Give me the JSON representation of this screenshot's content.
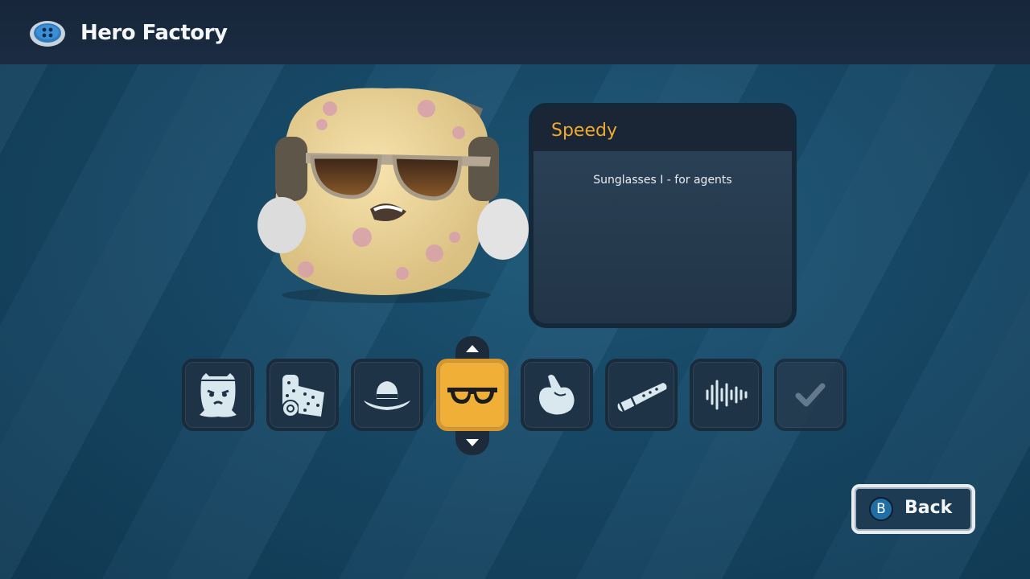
{
  "header": {
    "title": "Hero Factory",
    "logo_icon": "button-logo-icon"
  },
  "character": {
    "description_icon": "plush-character-with-sunglasses-and-headphones"
  },
  "info_panel": {
    "name": "Speedy",
    "description": "Sunglasses I - for agents"
  },
  "slots": [
    {
      "id": "body",
      "icon": "body-icon",
      "selected": false,
      "enabled": true
    },
    {
      "id": "pattern",
      "icon": "fabric-pattern-icon",
      "selected": false,
      "enabled": true
    },
    {
      "id": "hat",
      "icon": "hat-icon",
      "selected": false,
      "enabled": true
    },
    {
      "id": "glasses",
      "icon": "glasses-icon",
      "selected": true,
      "enabled": true
    },
    {
      "id": "hands",
      "icon": "hand-icon",
      "selected": false,
      "enabled": true
    },
    {
      "id": "belt",
      "icon": "belt-icon",
      "selected": false,
      "enabled": true
    },
    {
      "id": "voice",
      "icon": "sound-wave-icon",
      "selected": false,
      "enabled": true
    },
    {
      "id": "confirm",
      "icon": "checkmark-icon",
      "selected": false,
      "enabled": false
    }
  ],
  "back_button": {
    "badge": "B",
    "label": "Back"
  },
  "colors": {
    "accent": "#f0a92d",
    "selected_slot": "#f0b038"
  }
}
